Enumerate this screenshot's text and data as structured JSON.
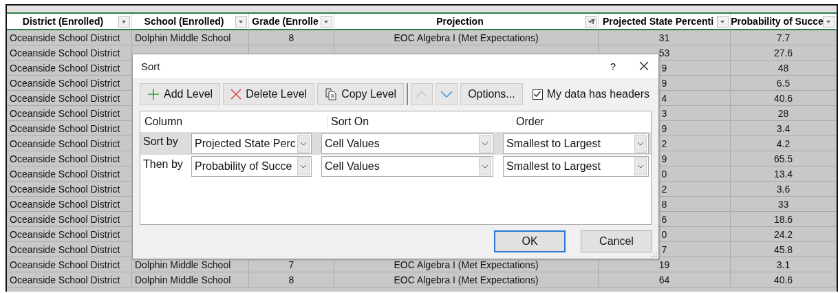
{
  "sheet": {
    "columns": [
      {
        "label": "District (Enrolled)",
        "filtered": false
      },
      {
        "label": "School (Enrolled)",
        "filtered": false
      },
      {
        "label": "Grade (Enrolle",
        "filtered": false
      },
      {
        "label": "Projection",
        "filtered": true
      },
      {
        "label": "Projected State Percenti",
        "filtered": false
      },
      {
        "label": "Probability of Succe",
        "filtered": false
      }
    ],
    "rows": [
      {
        "district": "Oceanside School District",
        "school": "Dolphin Middle School",
        "grade": "8",
        "projection": "EOC Algebra I (Met Expectations)",
        "percentile": "31",
        "probability": "7.7"
      },
      {
        "district": "Oceanside School District",
        "percentile": "53",
        "probability": "27.6"
      },
      {
        "district": "Oceanside School District",
        "percentile": "9",
        "probability": "48"
      },
      {
        "district": "Oceanside School District",
        "percentile": "9",
        "probability": "6.5"
      },
      {
        "district": "Oceanside School District",
        "percentile": "4",
        "probability": "40.6"
      },
      {
        "district": "Oceanside School District",
        "percentile": "3",
        "probability": "28"
      },
      {
        "district": "Oceanside School District",
        "percentile": "9",
        "probability": "3.4"
      },
      {
        "district": "Oceanside School District",
        "percentile": "2",
        "probability": "4.2"
      },
      {
        "district": "Oceanside School District",
        "percentile": "9",
        "probability": "65.5"
      },
      {
        "district": "Oceanside School District",
        "percentile": "0",
        "probability": "13.4"
      },
      {
        "district": "Oceanside School District",
        "percentile": "2",
        "probability": "3.6"
      },
      {
        "district": "Oceanside School District",
        "percentile": "8",
        "probability": "33"
      },
      {
        "district": "Oceanside School District",
        "percentile": "6",
        "probability": "18.6"
      },
      {
        "district": "Oceanside School District",
        "percentile": "0",
        "probability": "24.2"
      },
      {
        "district": "Oceanside School District",
        "percentile": "7",
        "probability": "45.8"
      },
      {
        "district": "Oceanside School District",
        "school": "Dolphin Middle School",
        "grade": "7",
        "projection": "EOC Algebra I (Met Expectations)",
        "percentile": "19",
        "probability": "3.1"
      },
      {
        "district": "Oceanside School District",
        "school": "Dolphin Middle School",
        "grade": "8",
        "projection": "EOC Algebra I (Met Expectations)",
        "percentile": "64",
        "probability": "40.6"
      }
    ]
  },
  "dialog": {
    "title": "Sort",
    "help": "?",
    "toolbar": [
      {
        "kind": "add",
        "label": "Add Level"
      },
      {
        "kind": "delete",
        "label": "Delete Level"
      },
      {
        "kind": "copy",
        "label": "Copy Level"
      },
      {
        "kind": "up",
        "disabled": true
      },
      {
        "kind": "down",
        "disabled": false
      },
      {
        "kind": "options",
        "label": "Options..."
      }
    ],
    "headers_checkbox": {
      "label": "My data has headers",
      "checked": true
    },
    "grid_headers": [
      "Column",
      "Sort On",
      "Order"
    ],
    "levels": [
      {
        "label": "Sort by",
        "column": "Projected State Perc",
        "sort_on": "Cell Values",
        "order": "Smallest to Largest",
        "selected": true
      },
      {
        "label": "Then by",
        "column": "Probability of Succe",
        "sort_on": "Cell Values",
        "order": "Smallest to Largest",
        "selected": false
      }
    ],
    "buttons": [
      {
        "label": "OK",
        "default": true
      },
      {
        "label": "Cancel",
        "default": false
      }
    ]
  }
}
